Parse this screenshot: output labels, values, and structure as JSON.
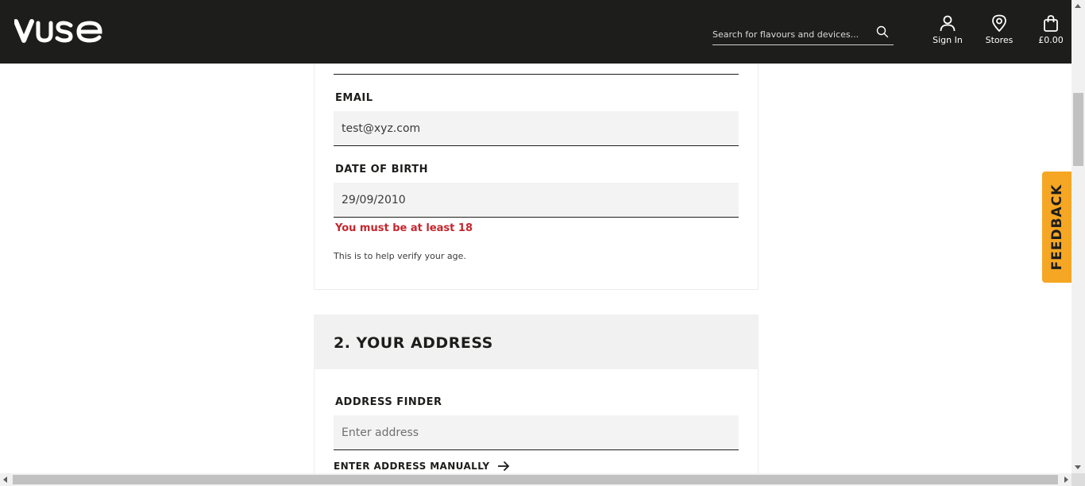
{
  "header": {
    "logo_text": "vuse",
    "search_placeholder": "Search for flavours and devices...",
    "search_icon": "search-icon",
    "signin_label": "Sign In",
    "stores_label": "Stores",
    "basket_total": "£0.00"
  },
  "form": {
    "email_label": "EMAIL",
    "email_value": "test@xyz.com",
    "dob_label": "DATE OF BIRTH",
    "dob_value": "29/09/2010",
    "dob_error": "You must be at least 18",
    "dob_helper": "This is to help verify your age."
  },
  "address": {
    "section_title": "2. YOUR ADDRESS",
    "finder_label": "ADDRESS FINDER",
    "finder_placeholder": "Enter address",
    "manual_link": "ENTER ADDRESS MANUALLY"
  },
  "feedback_label": "FEEDBACK",
  "colors": {
    "header_bg": "#1d1d1b",
    "error": "#c4262e",
    "feedback": "#f5a623",
    "field_bg": "#f3f3f3"
  }
}
